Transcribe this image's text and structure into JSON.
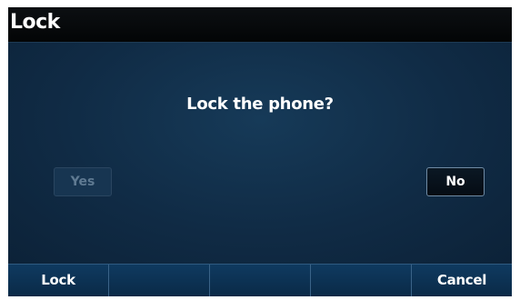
{
  "title_bar": {
    "title": "Lock"
  },
  "dialog": {
    "prompt": "Lock the phone?",
    "yes_label": "Yes",
    "no_label": "No"
  },
  "softkeys": [
    {
      "label": "Lock"
    },
    {
      "label": ""
    },
    {
      "label": ""
    },
    {
      "label": ""
    },
    {
      "label": "Cancel"
    }
  ],
  "colors": {
    "background": "#0c1f33",
    "title_bar": "#050709",
    "softkey_bar": "#0d3354",
    "text": "#ffffff",
    "disabled_text": "#5f7a92"
  }
}
